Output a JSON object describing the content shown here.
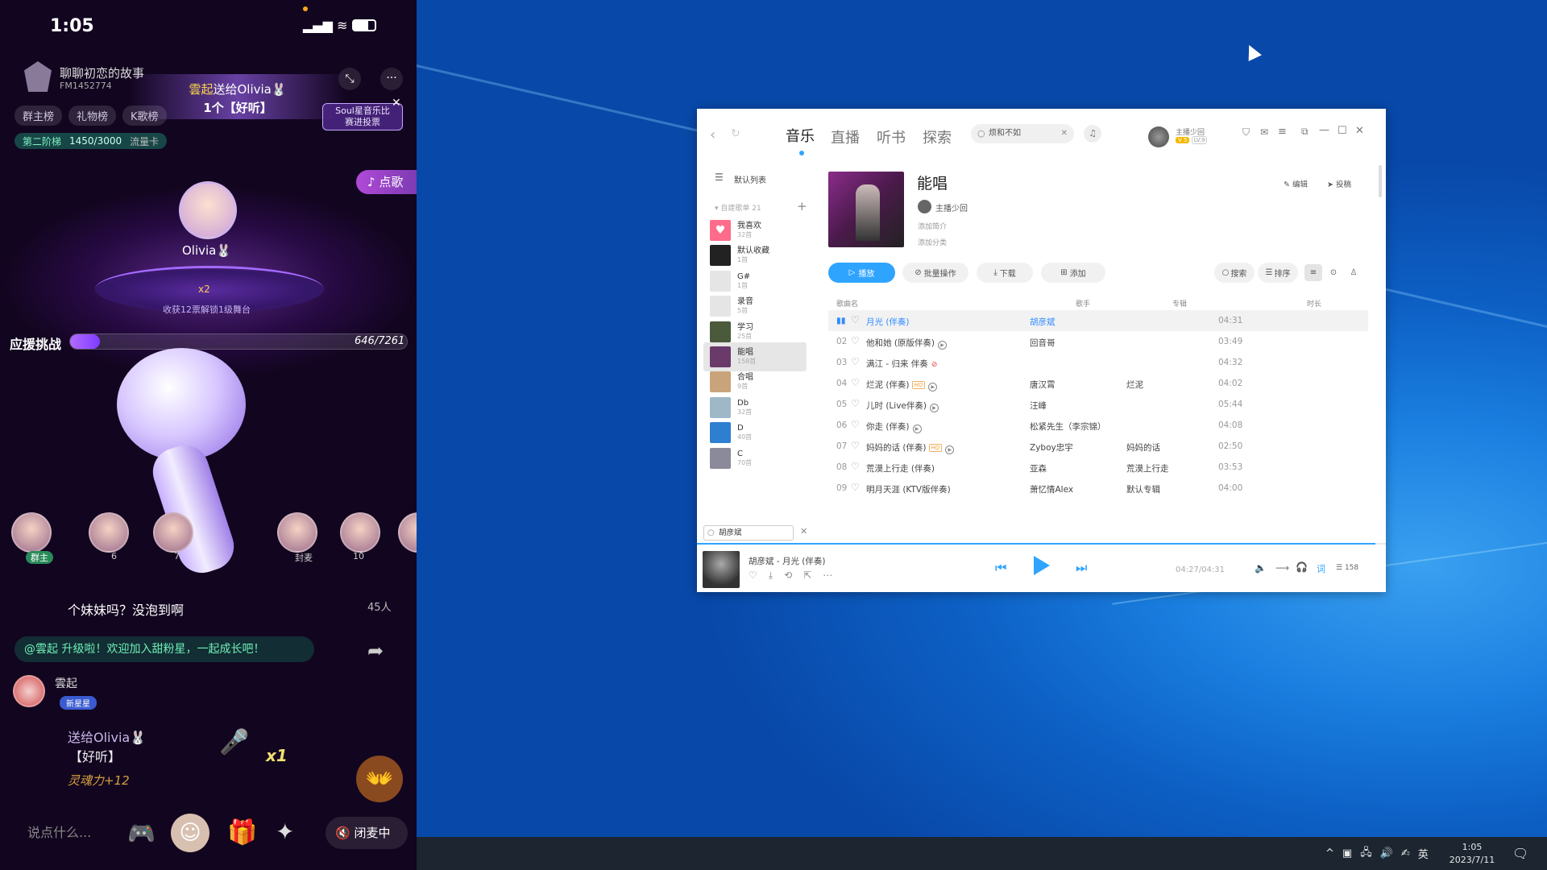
{
  "phone": {
    "time": "1:05",
    "room_title": "聊聊初恋的故事",
    "room_id": "FM1452774",
    "gift_banner_sender": "雲起",
    "gift_banner_text": "送给Olivia🐰",
    "gift_banner_count": "1个【好听】",
    "tabs": [
      "群主榜",
      "礼物榜",
      "K歌榜"
    ],
    "stage_label": "第二阶梯",
    "stage_progress": "1450/3000",
    "stage_tag": "流量卡",
    "order_song": "点歌",
    "host_name": "Olivia🐰",
    "stage_base_text": "收获12票解锁1级舞台",
    "stage_base_count": "x2",
    "challenge_label": "应援挑战",
    "challenge_progress": "646/7261",
    "challenge_fraction": 0.089,
    "seat_labels": [
      "群主",
      "6",
      "7",
      "",
      "封麦",
      "10"
    ],
    "chat_question": "个妹妹吗？没泡到啊",
    "online_count": "45人",
    "welcome_msg": "@雲起 升级啦！欢迎加入甜粉星，一起成长吧！",
    "user_name": "雲起",
    "user_badge": "新星星",
    "gift_line1": "送给Olivia🐰",
    "gift_line2": "【好听】",
    "gift_multiplier": "x1",
    "gift_score": "灵魂力+12",
    "soul_badge_line1": "Soul星音乐比",
    "soul_badge_line2": "赛进投票",
    "input_placeholder": "说点什么...",
    "mic_status": "闭麦中"
  },
  "window": {
    "nav_tabs": [
      "音乐",
      "直播",
      "听书",
      "探索"
    ],
    "search_value": "烦和不如",
    "user_name": "主播少回",
    "user_level": "LV.9",
    "sidebar_default": "默认列表",
    "sidebar_section": "自建歌单 21",
    "playlists": [
      {
        "name": "我喜欢",
        "count": "32首",
        "color": "#ff6b8a"
      },
      {
        "name": "默认收藏",
        "count": "1首",
        "color": "#222222"
      },
      {
        "name": "G#",
        "count": "1首",
        "color": "#e5e5e5"
      },
      {
        "name": "录音",
        "count": "5首",
        "color": "#e5e5e5"
      },
      {
        "name": "学习",
        "count": "25首",
        "color": "#4a5a3a"
      },
      {
        "name": "能唱",
        "count": "158首",
        "color": "#6a3a6a"
      },
      {
        "name": "合唱",
        "count": "9首",
        "color": "#c9a47a"
      },
      {
        "name": "Db",
        "count": "32首",
        "color": "#9fb8c8"
      },
      {
        "name": "D",
        "count": "40首",
        "color": "#2e7fd0"
      },
      {
        "name": "C",
        "count": "70首",
        "color": "#8a8a9a"
      }
    ],
    "sidebar_search": "胡彦斌",
    "playlist_title": "能唱",
    "owner": "主播少回",
    "add_intro": "添加简介",
    "add_category": "添加分类",
    "edit_label": "编辑",
    "contribute_label": "投稿",
    "actions": {
      "play": "播放",
      "batch": "批量操作",
      "download": "下载",
      "add": "添加",
      "search": "搜索",
      "sort": "排序"
    },
    "columns": {
      "name": "歌曲名",
      "artist": "歌手",
      "album": "专辑",
      "duration": "时长"
    },
    "songs": [
      {
        "no": "",
        "name": "月光 (伴奏)",
        "artist": "胡彦斌",
        "album": "",
        "duration": "04:31"
      },
      {
        "no": "02",
        "name": "他和她 (原版伴奏)",
        "artist": "回音哥",
        "album": "",
        "duration": "03:49"
      },
      {
        "no": "03",
        "name": "满江 - 归来 伴奏",
        "artist": "",
        "album": "",
        "duration": "04:32"
      },
      {
        "no": "04",
        "name": "烂泥 (伴奏)",
        "artist": "唐汉霄",
        "album": "烂泥",
        "duration": "04:02"
      },
      {
        "no": "05",
        "name": "儿时 (Live伴奏)",
        "artist": "汪峰",
        "album": "",
        "duration": "05:44"
      },
      {
        "no": "06",
        "name": "你走 (伴奏)",
        "artist": "松紧先生（李宗锦）",
        "album": "",
        "duration": "04:08"
      },
      {
        "no": "07",
        "name": "妈妈的话 (伴奏)",
        "artist": "Zyboy忠宇",
        "album": "妈妈的话",
        "duration": "02:50"
      },
      {
        "no": "08",
        "name": "荒漠上行走 (伴奏)",
        "artist": "亚森",
        "album": "荒漠上行走",
        "duration": "03:53"
      },
      {
        "no": "09",
        "name": "明月天涯 (KTV版伴奏)",
        "artist": "萧忆情Alex",
        "album": "默认专辑",
        "duration": "04:00"
      }
    ],
    "now_playing": "胡彦斌 - 月光 (伴奏)",
    "time_progress": "04:27/04:31",
    "playback_fraction": 0.985,
    "queue_count": "158"
  },
  "taskbar": {
    "ime": "英",
    "time": "1:05",
    "date": "2023/7/11"
  }
}
